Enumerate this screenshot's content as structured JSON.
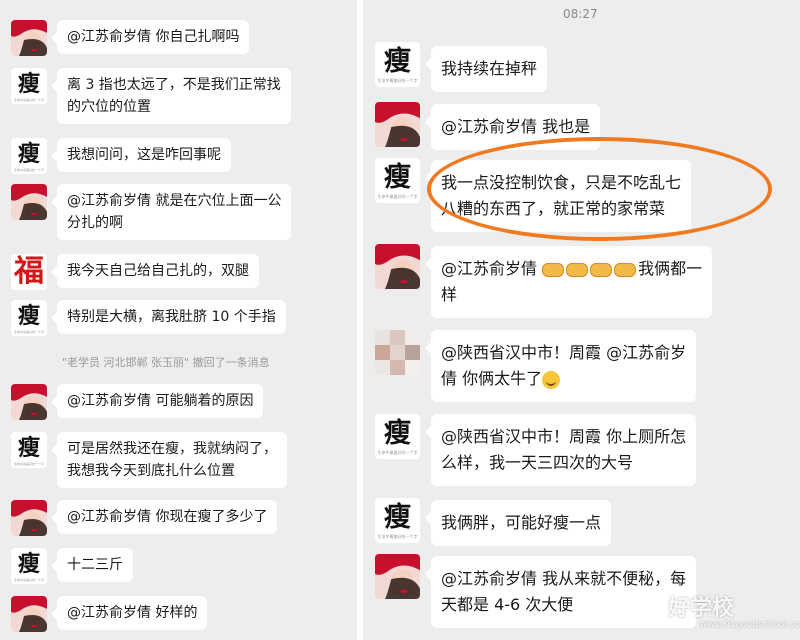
{
  "timestamp": "08:27",
  "colors": {
    "panel_bg": "#ededed",
    "bubble_bg": "#ffffff",
    "highlight": "#f07a20"
  },
  "left_messages": [
    {
      "avatar": "red-hat",
      "text": "@江苏俞岁倩  你自己扎啊吗"
    },
    {
      "avatar": "shou",
      "text": "离 3 指也太远了，不是我们正常找\n的穴位的位置"
    },
    {
      "avatar": "shou",
      "text": "我想问问，这是咋回事呢"
    },
    {
      "avatar": "red-hat",
      "text": "@江苏俞岁倩  就是在穴位上面一公\n分扎的啊"
    },
    {
      "avatar": "fu",
      "text": "我今天自己给自己扎的，双腿"
    },
    {
      "avatar": "shou",
      "text": "特别是大横，离我肚脐 10 个手指"
    },
    {
      "avatar": "red-hat",
      "text": "@江苏俞岁倩  可能躺着的原因"
    },
    {
      "avatar": "shou",
      "text": "可是居然我还在瘦，我就纳闷了，\n我想我今天到底扎什么位置"
    },
    {
      "avatar": "red-hat",
      "text": "@江苏俞岁倩  你现在瘦了多少了"
    },
    {
      "avatar": "shou",
      "text": "十二三斤"
    },
    {
      "avatar": "red-hat",
      "text": "@江苏俞岁倩  好样的"
    }
  ],
  "left_system_notice": "\"老学员 河北邯郸 张玉丽\" 撤回了一条消息",
  "right_messages": [
    {
      "avatar": "shou",
      "text": "我持续在掉秤"
    },
    {
      "avatar": "red-hat",
      "text": "@江苏俞岁倩  我也是"
    },
    {
      "avatar": "shou",
      "text": "我一点没控制饮食，只是不吃乱七\n八糟的东西了，就正常的家常菜"
    },
    {
      "avatar": "red-hat",
      "text_before": "@江苏俞岁倩  ",
      "emoji": "handshake",
      "emoji_count": 4,
      "text_after": "我俩都一\n样"
    },
    {
      "avatar": "mosaic",
      "text": "@陕西省汉中市！周霞  @江苏俞岁\n倩  你俩太牛了",
      "emoji": "smile"
    },
    {
      "avatar": "shou",
      "text": "@陕西省汉中市！周霞  你上厕所怎\n么样，我一天三四次的大号"
    },
    {
      "avatar": "shou",
      "text": "我俩胖，可能好瘦一点"
    },
    {
      "avatar": "red-hat",
      "text": "@江苏俞岁倩  我从来就不便秘，每\n天都是 4-6 次大便"
    }
  ],
  "avatar_labels": {
    "shou_char": "瘦",
    "fu_char": "福",
    "shou_subtext": "生命中最美好的一个字"
  },
  "watermark": {
    "main": "好学校",
    "sub": "www.91goodschool.com"
  }
}
